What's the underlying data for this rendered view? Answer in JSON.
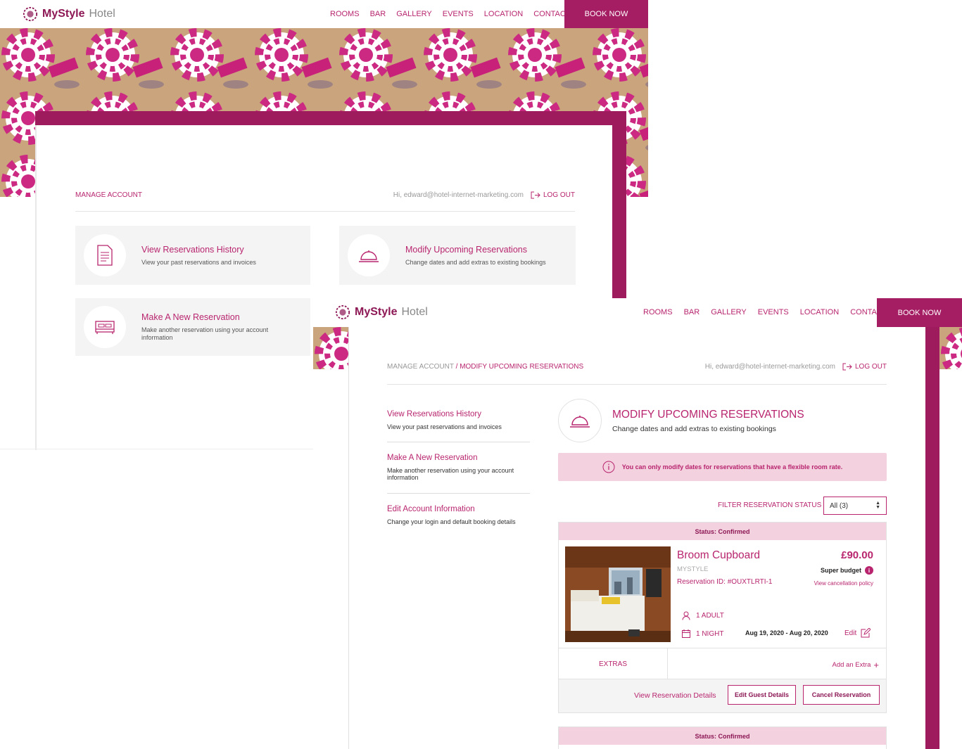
{
  "brand": {
    "name_bold": "MyStyle",
    "name_light": "Hotel"
  },
  "nav": {
    "links": [
      "ROOMS",
      "BAR",
      "GALLERY",
      "EVENTS",
      "LOCATION",
      "CONTACT"
    ],
    "book_now": "BOOK NOW"
  },
  "colors": {
    "accent": "#b8256e",
    "accent_dark": "#9e1c5d",
    "notice_bg": "#f3d1df"
  },
  "back": {
    "section_label": "MANAGE ACCOUNT",
    "greeting": "Hi, edward@hotel-internet-marketing.com",
    "logout": "LOG OUT",
    "cards": [
      {
        "icon": "document-icon",
        "title": "View Reservations History",
        "desc": "View your past reservations and invoices"
      },
      {
        "icon": "service-bell-icon",
        "title": "Modify Upcoming Reservations",
        "desc": "Change dates and add extras to existing bookings"
      },
      {
        "icon": "bed-icon",
        "title": "Make A New Reservation",
        "desc": "Make another reservation using your account information"
      }
    ]
  },
  "front": {
    "breadcrumb_root": "MANAGE ACCOUNT",
    "breadcrumb_sep": " / ",
    "breadcrumb_current": "MODIFY UPCOMING RESERVATIONS",
    "greeting": "Hi, edward@hotel-internet-marketing.com",
    "logout": "LOG OUT",
    "sidebar": [
      {
        "title": "View Reservations History",
        "desc": "View your past reservations and invoices"
      },
      {
        "title": "Make A New Reservation",
        "desc": "Make another reservation using your account information"
      },
      {
        "title": "Edit Account Information",
        "desc": "Change your login and default booking details"
      }
    ],
    "heading": "MODIFY UPCOMING RESERVATIONS",
    "subheading": "Change dates and add extras to existing bookings",
    "notice": "You can only modify dates for reservations that have a flexible room rate.",
    "filter_label": "FILTER RESERVATION STATUS",
    "filter_value": "All (3)",
    "reservation": {
      "status": "Status: Confirmed",
      "room": "Broom Cupboard",
      "hotel": "MYSTYLE",
      "reservation_id": "Reservation ID: #OUXTLRTI-1",
      "price": "£90.00",
      "rate": "Super budget",
      "cancellation": "View cancellation policy",
      "guests": "1 ADULT",
      "nights": "1 NIGHT",
      "dates": "Aug 19, 2020 - Aug 20, 2020",
      "edit": "Edit",
      "extras_label": "EXTRAS",
      "add_extra": "Add an Extra",
      "view_details": "View Reservation Details",
      "edit_guest": "Edit Guest Details",
      "cancel": "Cancel Reservation"
    },
    "reservation2": {
      "status": "Status: Confirmed"
    }
  }
}
